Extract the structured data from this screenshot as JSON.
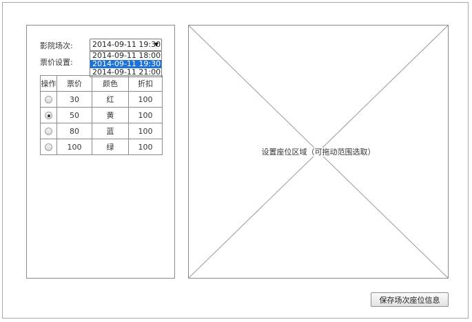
{
  "session": {
    "label": "影院场次:",
    "selected": "2014-09-11 19:30",
    "options": [
      {
        "value": "2014-09-11 18:00",
        "selected": false
      },
      {
        "value": "2014-09-11 19:30",
        "selected": true
      },
      {
        "value": "2014-09-11 21:00",
        "selected": false
      }
    ]
  },
  "price_settings": {
    "label": "票价设置:",
    "headers": [
      "操作",
      "票价",
      "颜色",
      "折扣"
    ],
    "rows": [
      {
        "checked": false,
        "price": "30",
        "color": "红",
        "discount": "100"
      },
      {
        "checked": true,
        "price": "50",
        "color": "黄",
        "discount": "100"
      },
      {
        "checked": false,
        "price": "80",
        "color": "蓝",
        "discount": "100"
      },
      {
        "checked": false,
        "price": "100",
        "color": "绿",
        "discount": "100"
      }
    ]
  },
  "seat_area": {
    "label": "设置座位区域（可拖动范围选取）"
  },
  "actions": {
    "save_label": "保存场次座位信息"
  },
  "icons": {
    "select_arrow": "chevron-down-icon"
  },
  "colors": {
    "selected_option_bg": "#1e73d9"
  }
}
